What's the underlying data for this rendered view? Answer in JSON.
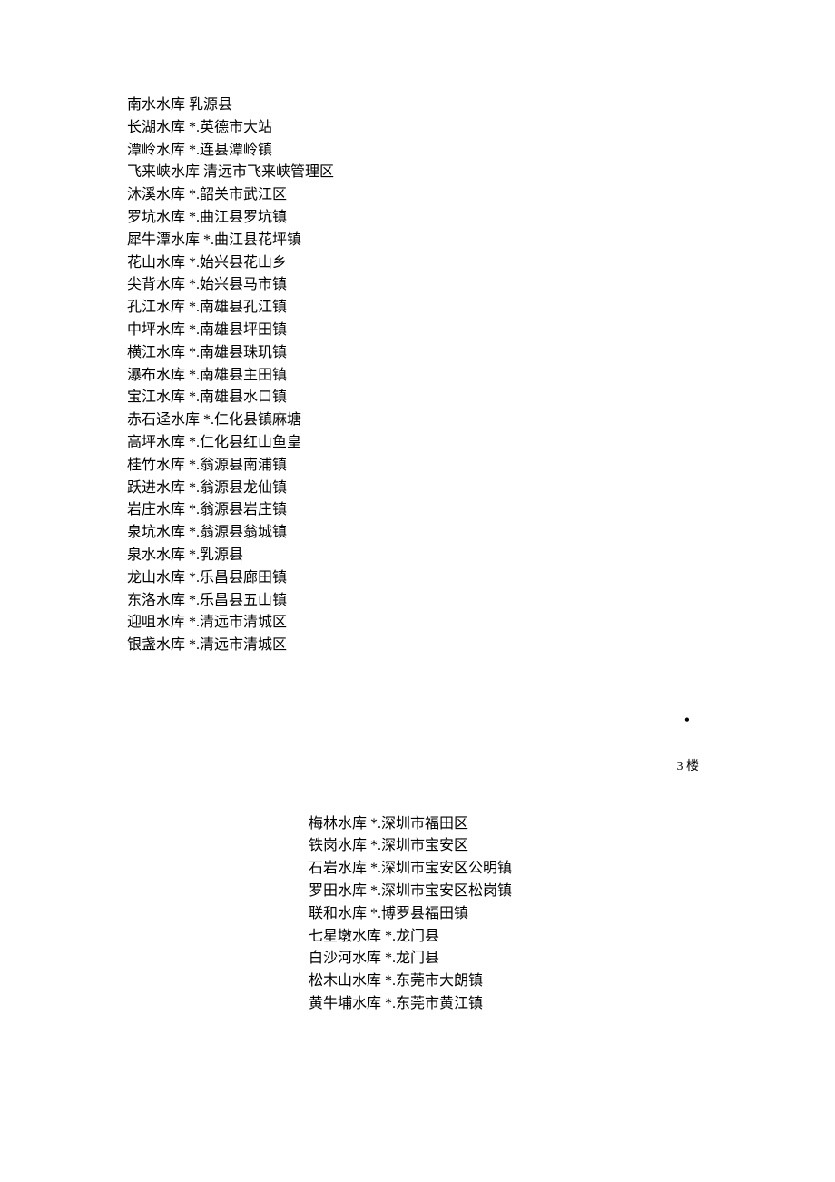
{
  "block1": [
    {
      "name": "南水水库",
      "loc": "乳源县"
    },
    {
      "name": "长湖水库",
      "loc": "*.英德市大站"
    },
    {
      "name": "潭岭水库",
      "loc": "*.连县潭岭镇"
    },
    {
      "name": "飞来峡水库",
      "loc": "清远市飞来峡管理区"
    },
    {
      "name": "沐溪水库",
      "loc": "*.韶关市武江区"
    },
    {
      "name": "罗坑水库",
      "loc": "*.曲江县罗坑镇"
    },
    {
      "name": "犀牛潭水库",
      "loc": "*.曲江县花坪镇"
    },
    {
      "name": "花山水库",
      "loc": "*.始兴县花山乡"
    },
    {
      "name": "尖背水库",
      "loc": "*.始兴县马市镇"
    },
    {
      "name": "孔江水库",
      "loc": "*.南雄县孔江镇"
    },
    {
      "name": "中坪水库",
      "loc": "*.南雄县坪田镇"
    },
    {
      "name": "横江水库",
      "loc": "*.南雄县珠玑镇"
    },
    {
      "name": "瀑布水库",
      "loc": "*.南雄县主田镇"
    },
    {
      "name": "宝江水库",
      "loc": "*.南雄县水口镇"
    },
    {
      "name": "赤石迳水库",
      "loc": "*.仁化县镇麻塘"
    },
    {
      "name": "高坪水库",
      "loc": "*.仁化县红山鱼皇"
    },
    {
      "name": "桂竹水库",
      "loc": "*.翁源县南浦镇"
    },
    {
      "name": "跃进水库",
      "loc": "*.翁源县龙仙镇"
    },
    {
      "name": "岩庄水库",
      "loc": "*.翁源县岩庄镇"
    },
    {
      "name": "泉坑水库",
      "loc": "*.翁源县翁城镇"
    },
    {
      "name": "泉水水库",
      "loc": "*.乳源县"
    },
    {
      "name": "龙山水库",
      "loc": "*.乐昌县廊田镇"
    },
    {
      "name": "东洛水库",
      "loc": "*.乐昌县五山镇"
    },
    {
      "name": "迎咀水库",
      "loc": "*.清远市清城区"
    },
    {
      "name": "银盏水库",
      "loc": "*.清远市清城区"
    }
  ],
  "meta": {
    "bullet": "•",
    "floor": "3 楼"
  },
  "block2": [
    {
      "name": "梅林水库",
      "loc": "*.深圳市福田区"
    },
    {
      "name": "铁岗水库",
      "loc": "*.深圳市宝安区"
    },
    {
      "name": "石岩水库",
      "loc": "*.深圳市宝安区公明镇"
    },
    {
      "name": "罗田水库",
      "loc": "*.深圳市宝安区松岗镇"
    },
    {
      "name": "联和水库",
      "loc": "*.博罗县福田镇"
    },
    {
      "name": "七星墩水库",
      "loc": "*.龙门县"
    },
    {
      "name": "白沙河水库",
      "loc": "*.龙门县"
    },
    {
      "name": "松木山水库",
      "loc": "*.东莞市大朗镇"
    },
    {
      "name": "黄牛埔水库",
      "loc": "*.东莞市黄江镇"
    }
  ]
}
